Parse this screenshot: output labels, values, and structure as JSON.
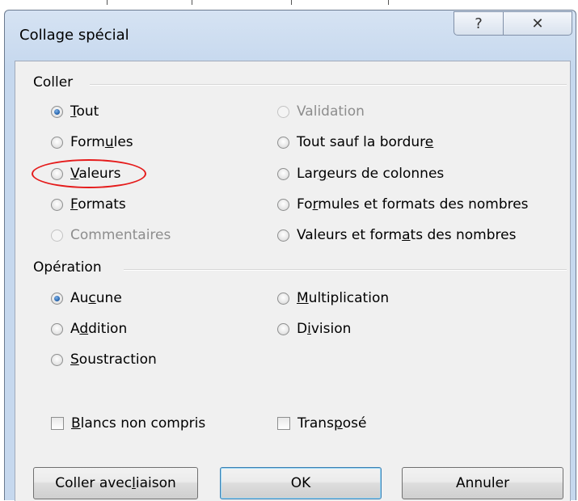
{
  "window": {
    "title": "Collage spécial",
    "help_glyph": "?",
    "close_glyph": "✕"
  },
  "coller": {
    "label": "Coller",
    "options": [
      {
        "pre": "",
        "u": "T",
        "post": "out",
        "checked": true,
        "disabled": false
      },
      {
        "pre": "Form",
        "u": "u",
        "post": "les",
        "checked": false,
        "disabled": false
      },
      {
        "pre": "",
        "u": "V",
        "post": "aleurs",
        "checked": false,
        "disabled": false
      },
      {
        "pre": "",
        "u": "F",
        "post": "ormats",
        "checked": false,
        "disabled": false
      },
      {
        "pre": "Commentaires",
        "u": "",
        "post": "",
        "checked": false,
        "disabled": true
      },
      {
        "pre": "Validation",
        "u": "",
        "post": "",
        "checked": false,
        "disabled": true
      },
      {
        "pre": "Tout sauf la bordur",
        "u": "e",
        "post": "",
        "checked": false,
        "disabled": false
      },
      {
        "pre": "Lar",
        "u": "g",
        "post": "eurs de colonnes",
        "checked": false,
        "disabled": false
      },
      {
        "pre": "Fo",
        "u": "r",
        "post": "mules et formats des nombres",
        "checked": false,
        "disabled": false
      },
      {
        "pre": "Valeurs et form",
        "u": "a",
        "post": "ts des nombres",
        "checked": false,
        "disabled": false
      }
    ]
  },
  "operation": {
    "label": "Opération",
    "options": [
      {
        "pre": "Au",
        "u": "c",
        "post": "une",
        "checked": true
      },
      {
        "pre": "A",
        "u": "d",
        "post": "dition",
        "checked": false
      },
      {
        "pre": "",
        "u": "S",
        "post": "oustraction",
        "checked": false
      },
      {
        "pre": "",
        "u": "M",
        "post": "ultiplication",
        "checked": false
      },
      {
        "pre": "D",
        "u": "i",
        "post": "vision",
        "checked": false
      }
    ]
  },
  "checks": [
    {
      "pre": "",
      "u": "B",
      "post": "lancs non compris",
      "checked": false
    },
    {
      "pre": "Trans",
      "u": "p",
      "post": "osé",
      "checked": false
    }
  ],
  "buttons": {
    "link": {
      "pre": "Coller avec ",
      "u": "l",
      "post": "iaison"
    },
    "ok": "OK",
    "cancel": "Annuler"
  },
  "highlight_color": "#e51b1b",
  "radio_checked_color": "#1f5ea8"
}
